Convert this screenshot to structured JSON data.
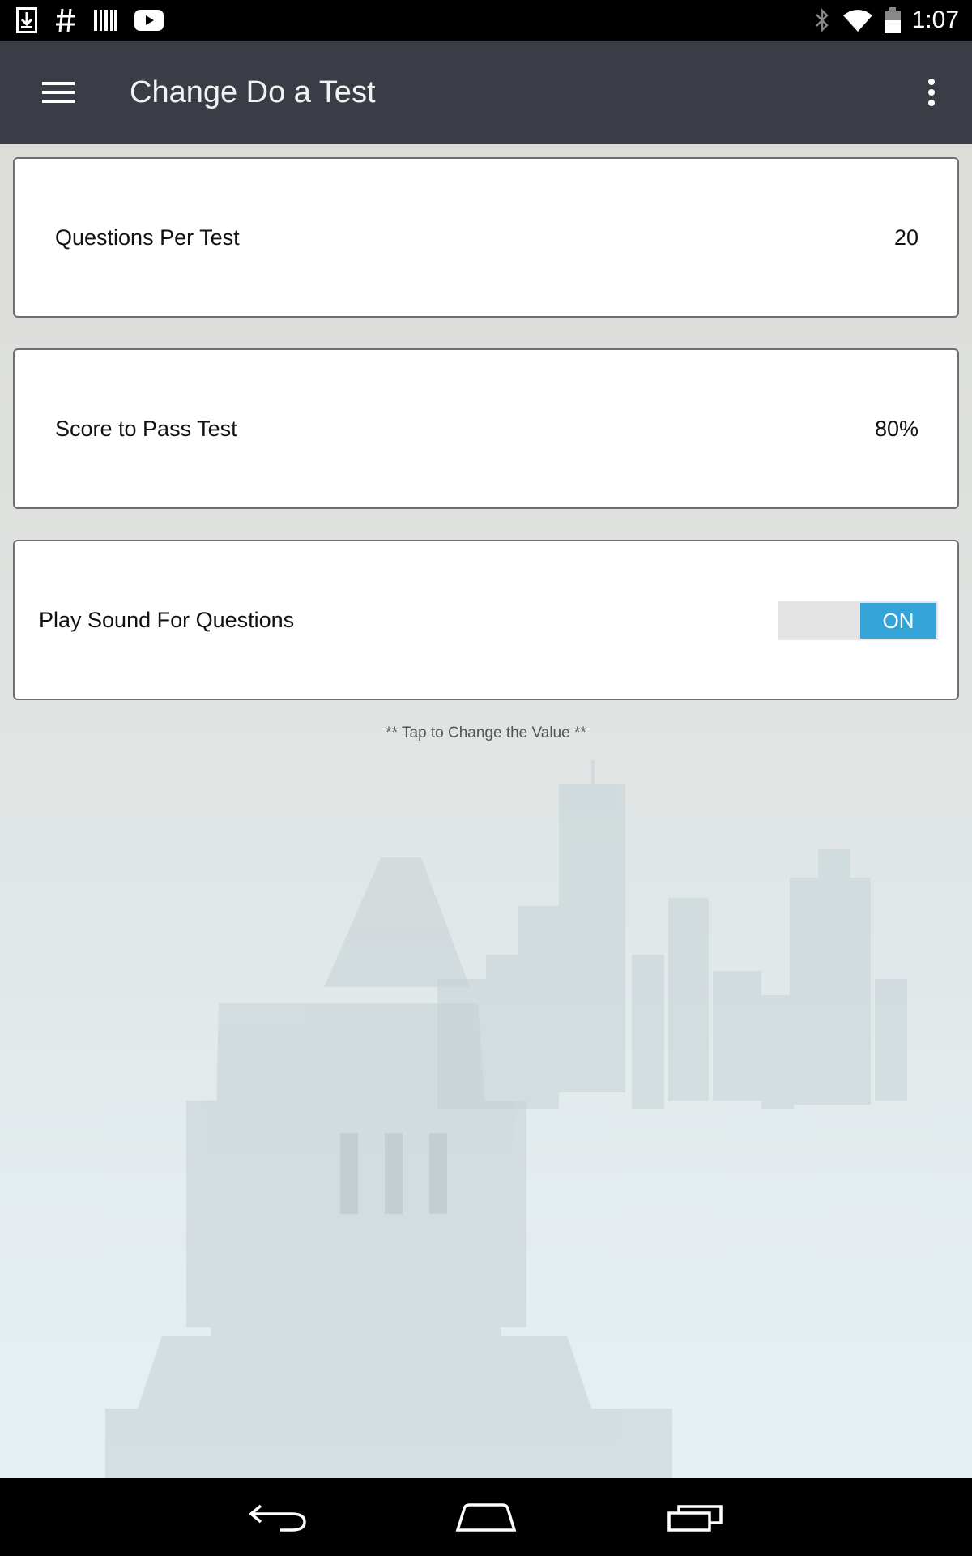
{
  "status_bar": {
    "time": "1:07",
    "left_icons": [
      "download-icon",
      "hash-icon",
      "barcode-icon",
      "youtube-icon"
    ],
    "right_icons": [
      "bluetooth-icon",
      "wifi-icon",
      "battery-icon"
    ]
  },
  "app_bar": {
    "title": "Change Do a Test",
    "menu_icon": "hamburger-menu-icon",
    "overflow_icon": "more-vert-icon"
  },
  "settings": [
    {
      "label": "Questions Per Test",
      "value": "20"
    },
    {
      "label": "Score to Pass Test",
      "value": "80%"
    },
    {
      "label": "Play Sound For Questions",
      "toggle": "ON"
    }
  ],
  "hint": "**  Tap to Change the Value  **",
  "colors": {
    "app_bar": "#3a3d46",
    "toggle_on": "#33a3d8"
  },
  "nav_bar": [
    "back-icon",
    "home-icon",
    "recents-icon"
  ]
}
